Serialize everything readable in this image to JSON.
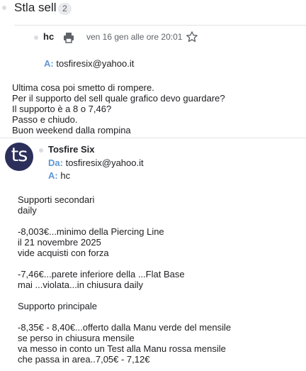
{
  "subject": {
    "title": "Stla sell",
    "count": "2"
  },
  "message1": {
    "sender": "hc",
    "date": "ven 16 gen alle ore 20:01",
    "to_label": "A:",
    "to_value": "tosfiresix@yahoo.it",
    "body_lines": [
      "Ultima cosa poi smetto di rompere.",
      "Per il supporto del sell quale grafico devo guardare?",
      "Il supporto è a 8 o 7,46?",
      "Passo e chiudo.",
      "Buon weekend dalla rompina"
    ]
  },
  "message2": {
    "avatar_text": "ts",
    "sender": "Tosfire Six",
    "from_label": "Da:",
    "from_value": "tosfiresix@yahoo.it",
    "to_label": "A:",
    "to_value": "hc",
    "body_lines": [
      "Supporti secondari",
      "daily",
      "",
      "-8,003€...minimo della Piercing Line",
      "il 21 novembre 2025",
      "vide acquisti con forza",
      "",
      "-7,46€...parete inferiore della ...Flat Base",
      "mai ...violata...in chiusura daily",
      "",
      "Supporto principale",
      "",
      "-8,35€ - 8,40€...offerto dalla Manu verde del mensile",
      "se perso in chiusura mensile",
      "va messo in conto un Test alla Manu rossa mensile",
      "che passa in area..7,05€ - 7,12€"
    ]
  },
  "icons": {
    "print": "print-icon",
    "star": "star-outline-icon"
  },
  "colors": {
    "avatar_bg": "#2b2f5a",
    "label_blue": "#5e97d6",
    "badge_bg": "#e8eaed"
  }
}
